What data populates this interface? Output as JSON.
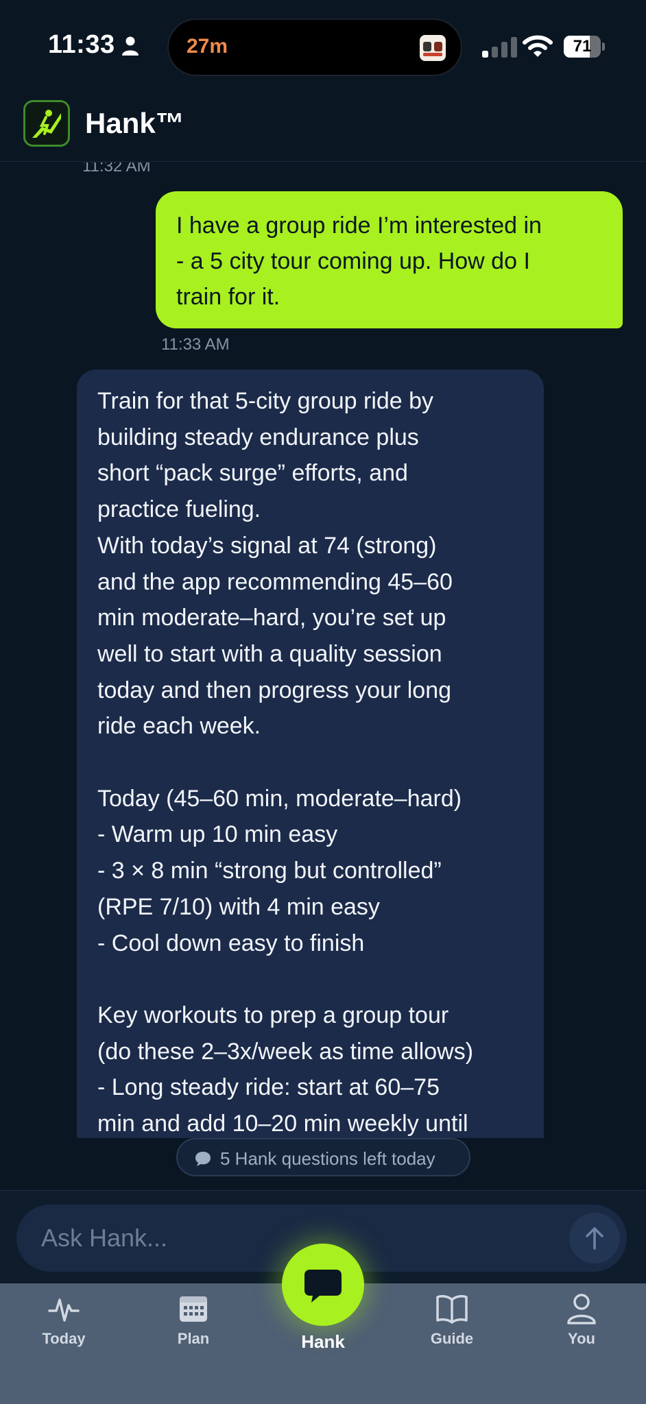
{
  "status_bar": {
    "time": "11:33",
    "island_timer": "27m",
    "battery_level": 71,
    "battery_label": "71"
  },
  "header": {
    "title": "Hank™"
  },
  "chat": {
    "messages": [
      {
        "role": "user",
        "timestamp": "11:32 AM",
        "lines": [
          "I have a group ride I’m interested in",
          "- a 5 city tour coming up. How do I",
          "train for it."
        ]
      },
      {
        "role": "assistant",
        "timestamp": "11:33 AM",
        "lines": [
          "Train for that 5-city group ride by",
          "building steady endurance plus",
          "short “pack surge” efforts, and",
          "practice fueling.",
          "With today’s signal at 74 (strong)",
          "and the app recommending 45–60",
          "min moderate–hard, you’re set up",
          "well to start with a quality session",
          "today and then progress your long",
          "ride each week.",
          "",
          "Today (45–60 min, moderate–hard)",
          "- Warm up 10 min easy",
          "- 3 × 8 min “strong but controlled”",
          "(RPE 7/10) with 4 min easy",
          "- Cool down easy to finish",
          "",
          "Key workouts to prep a group tour",
          "(do these 2–3x/week as time allows)",
          "- Long steady ride: start at 60–75",
          "min and add 10–20 min weekly until"
        ]
      }
    ],
    "quota_text": "5 Hank questions left today"
  },
  "input": {
    "placeholder": "Ask Hank..."
  },
  "tabs": [
    {
      "label": "Today",
      "icon": "pulse-icon"
    },
    {
      "label": "Plan",
      "icon": "calendar-icon"
    },
    {
      "label": "Hank",
      "icon": "chat-bubble-icon"
    },
    {
      "label": "Guide",
      "icon": "book-icon"
    },
    {
      "label": "You",
      "icon": "person-icon"
    }
  ],
  "colors": {
    "background": "#0a1622",
    "accent": "#a8f01f",
    "assistant_bubble": "#1c2b4a",
    "tab_bar": "#4f5f74"
  }
}
